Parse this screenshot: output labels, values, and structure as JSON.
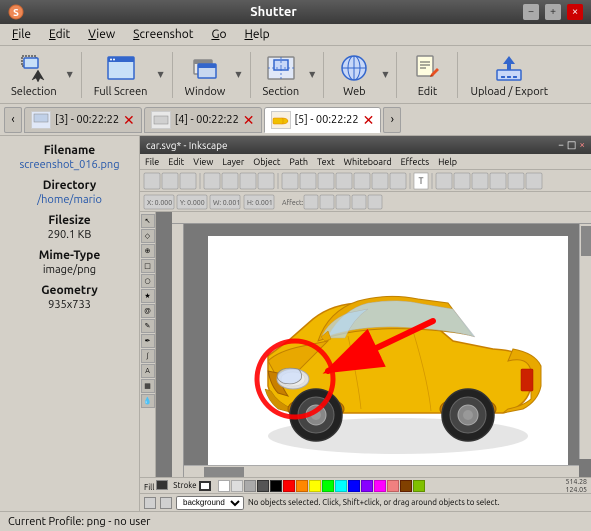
{
  "app": {
    "title": "Shutter",
    "title_icon": "S"
  },
  "title_bar": {
    "minimize_label": "−",
    "maximize_label": "+",
    "close_label": "×"
  },
  "menu": {
    "items": [
      {
        "id": "file",
        "label": "File",
        "underline_index": 0
      },
      {
        "id": "edit",
        "label": "Edit",
        "underline_index": 0
      },
      {
        "id": "view",
        "label": "View",
        "underline_index": 0
      },
      {
        "id": "screenshot",
        "label": "Screenshot",
        "underline_index": 0
      },
      {
        "id": "go",
        "label": "Go",
        "underline_index": 0
      },
      {
        "id": "help",
        "label": "Help",
        "underline_index": 0
      }
    ]
  },
  "toolbar": {
    "buttons": [
      {
        "id": "selection",
        "label": "Selection",
        "icon": "✂"
      },
      {
        "id": "fullscreen",
        "label": "Full Screen",
        "icon": "⛶"
      },
      {
        "id": "window",
        "label": "Window",
        "icon": "▣"
      },
      {
        "id": "section",
        "label": "Section",
        "icon": "⊞"
      },
      {
        "id": "web",
        "label": "Web",
        "icon": "🌐"
      },
      {
        "id": "edit",
        "label": "Edit",
        "icon": "✏"
      },
      {
        "id": "upload",
        "label": "Upload / Export",
        "icon": "⬆"
      }
    ]
  },
  "tabs": [
    {
      "id": "tab3",
      "label": "[3] - 00:22:22",
      "active": false
    },
    {
      "id": "tab4",
      "label": "[4] - 00:22:22",
      "active": false
    },
    {
      "id": "tab5",
      "label": "[5] - 00:22:22",
      "active": true
    }
  ],
  "sidebar": {
    "filename_label": "Filename",
    "filename_value": "screenshot_016.png",
    "directory_label": "Directory",
    "directory_value": "/home/mario",
    "filesize_label": "Filesize",
    "filesize_value": "290.1 KB",
    "mimetype_label": "Mime-Type",
    "mimetype_value": "image/png",
    "geometry_label": "Geometry",
    "geometry_value": "935x733"
  },
  "inkscape": {
    "title": "car.svg* - Inkscape",
    "close_btn": "×",
    "menu_items": [
      "File",
      "Edit",
      "View",
      "Layer",
      "Object",
      "Path",
      "Text",
      "Whiteboard",
      "Effects",
      "Help"
    ]
  },
  "status_bar": {
    "text": "Current Profile: png - no user"
  }
}
